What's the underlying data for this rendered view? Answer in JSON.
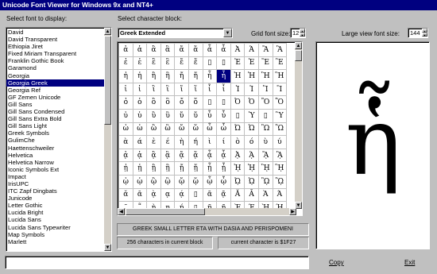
{
  "window": {
    "title": "Unicode Font Viewer for Windows 9x and NT4+"
  },
  "labels": {
    "select_font": "Select font to display:",
    "select_block": "Select character block:",
    "grid_font_size": "Grid font size:",
    "large_font_size": "Large view font size:"
  },
  "fonts": {
    "items": [
      "David",
      "David Transparent",
      "Ethiopia Jiret",
      "Fixed Miriam Transparent",
      "Franklin Gothic Book",
      "Garamond",
      "Georgia",
      "Georgia Greek",
      "Georgia Ref",
      "GF Zemen Unicode",
      "Gill Sans",
      "Gill Sans Condensed",
      "Gill Sans Extra Bold",
      "Gill Sans Light",
      "Greek Symbols",
      "GulimChe",
      "Haettenschweiler",
      "Helvetica",
      "Helvetica Narrow",
      "Iconic Symbols Ext",
      "Impact",
      "IrisUPC",
      "ITC Zapf Dingbats",
      "Junicode",
      "Letter Gothic",
      "Lucida Bright",
      "Lucida Sans",
      "Lucida Sans Typewriter",
      "Map Symbols",
      "Marlett"
    ],
    "selected": "Georgia Greek"
  },
  "char_block": {
    "value": "Greek Extended"
  },
  "grid_font_size": "12",
  "large_font_size": "144",
  "grid": {
    "rows": [
      [
        "ἀ",
        "ἁ",
        "ἂ",
        "ἃ",
        "ἄ",
        "ἅ",
        "ἆ",
        "ἇ",
        "Ἀ",
        "Ἁ",
        "Ἂ",
        "Ἃ"
      ],
      [
        "ἐ",
        "ἑ",
        "ἒ",
        "ἓ",
        "ἔ",
        "ἕ",
        "▯",
        "▯",
        "Ἐ",
        "Ἑ",
        "Ἒ",
        "Ἓ"
      ],
      [
        "ἠ",
        "ἡ",
        "ἢ",
        "ἣ",
        "ἤ",
        "ἥ",
        "ἦ",
        "ἧ",
        "Ἠ",
        "Ἡ",
        "Ἢ",
        "Ἣ"
      ],
      [
        "ἰ",
        "ἱ",
        "ἲ",
        "ἳ",
        "ἴ",
        "ἵ",
        "ἶ",
        "ἷ",
        "Ἰ",
        "Ἱ",
        "Ἲ",
        "Ἳ"
      ],
      [
        "ὀ",
        "ὁ",
        "ὂ",
        "ὃ",
        "ὄ",
        "ὅ",
        "▯",
        "▯",
        "Ὀ",
        "Ὁ",
        "Ὂ",
        "Ὃ"
      ],
      [
        "ὐ",
        "ὑ",
        "ὒ",
        "ὓ",
        "ὔ",
        "ὕ",
        "ὖ",
        "ὗ",
        "▯",
        "Ὑ",
        "▯",
        "Ὓ"
      ],
      [
        "ὠ",
        "ὡ",
        "ὢ",
        "ὣ",
        "ὤ",
        "ὥ",
        "ὦ",
        "ὧ",
        "Ὠ",
        "Ὡ",
        "Ὢ",
        "Ὣ"
      ],
      [
        "ὰ",
        "ά",
        "ὲ",
        "έ",
        "ὴ",
        "ή",
        "ὶ",
        "ί",
        "ὸ",
        "ό",
        "ὺ",
        "ύ"
      ],
      [
        "ᾀ",
        "ᾁ",
        "ᾂ",
        "ᾃ",
        "ᾄ",
        "ᾅ",
        "ᾆ",
        "ᾇ",
        "ᾈ",
        "ᾉ",
        "ᾊ",
        "ᾋ"
      ],
      [
        "ᾐ",
        "ᾑ",
        "ᾒ",
        "ᾓ",
        "ᾔ",
        "ᾕ",
        "ᾖ",
        "ᾗ",
        "ᾘ",
        "ᾙ",
        "ᾚ",
        "ᾛ"
      ],
      [
        "ᾠ",
        "ᾡ",
        "ᾢ",
        "ᾣ",
        "ᾤ",
        "ᾥ",
        "ᾦ",
        "ᾧ",
        "ᾨ",
        "ᾩ",
        "ᾪ",
        "ᾫ"
      ],
      [
        "ᾰ",
        "ᾱ",
        "ᾲ",
        "ᾳ",
        "ᾴ",
        "▯",
        "ᾶ",
        "ᾷ",
        "Ᾰ",
        "Ᾱ",
        "Ὰ",
        "Ά"
      ],
      [
        "῀",
        "῁",
        "ῂ",
        "ῃ",
        "ῄ",
        "▯",
        "ῆ",
        "ῇ",
        "Ὲ",
        "Έ",
        "Ὴ",
        "Ή"
      ]
    ],
    "selected_row": 2,
    "selected_col": 7
  },
  "large_view": {
    "char": "ἧ"
  },
  "char_name": "GREEK SMALL LETTER ETA WITH DASIA AND PERISPOMENI",
  "block_count": "256 characters in current block",
  "current_char": "current character is $1F27",
  "buttons": {
    "copy": "Copy",
    "exit": "Exit"
  }
}
